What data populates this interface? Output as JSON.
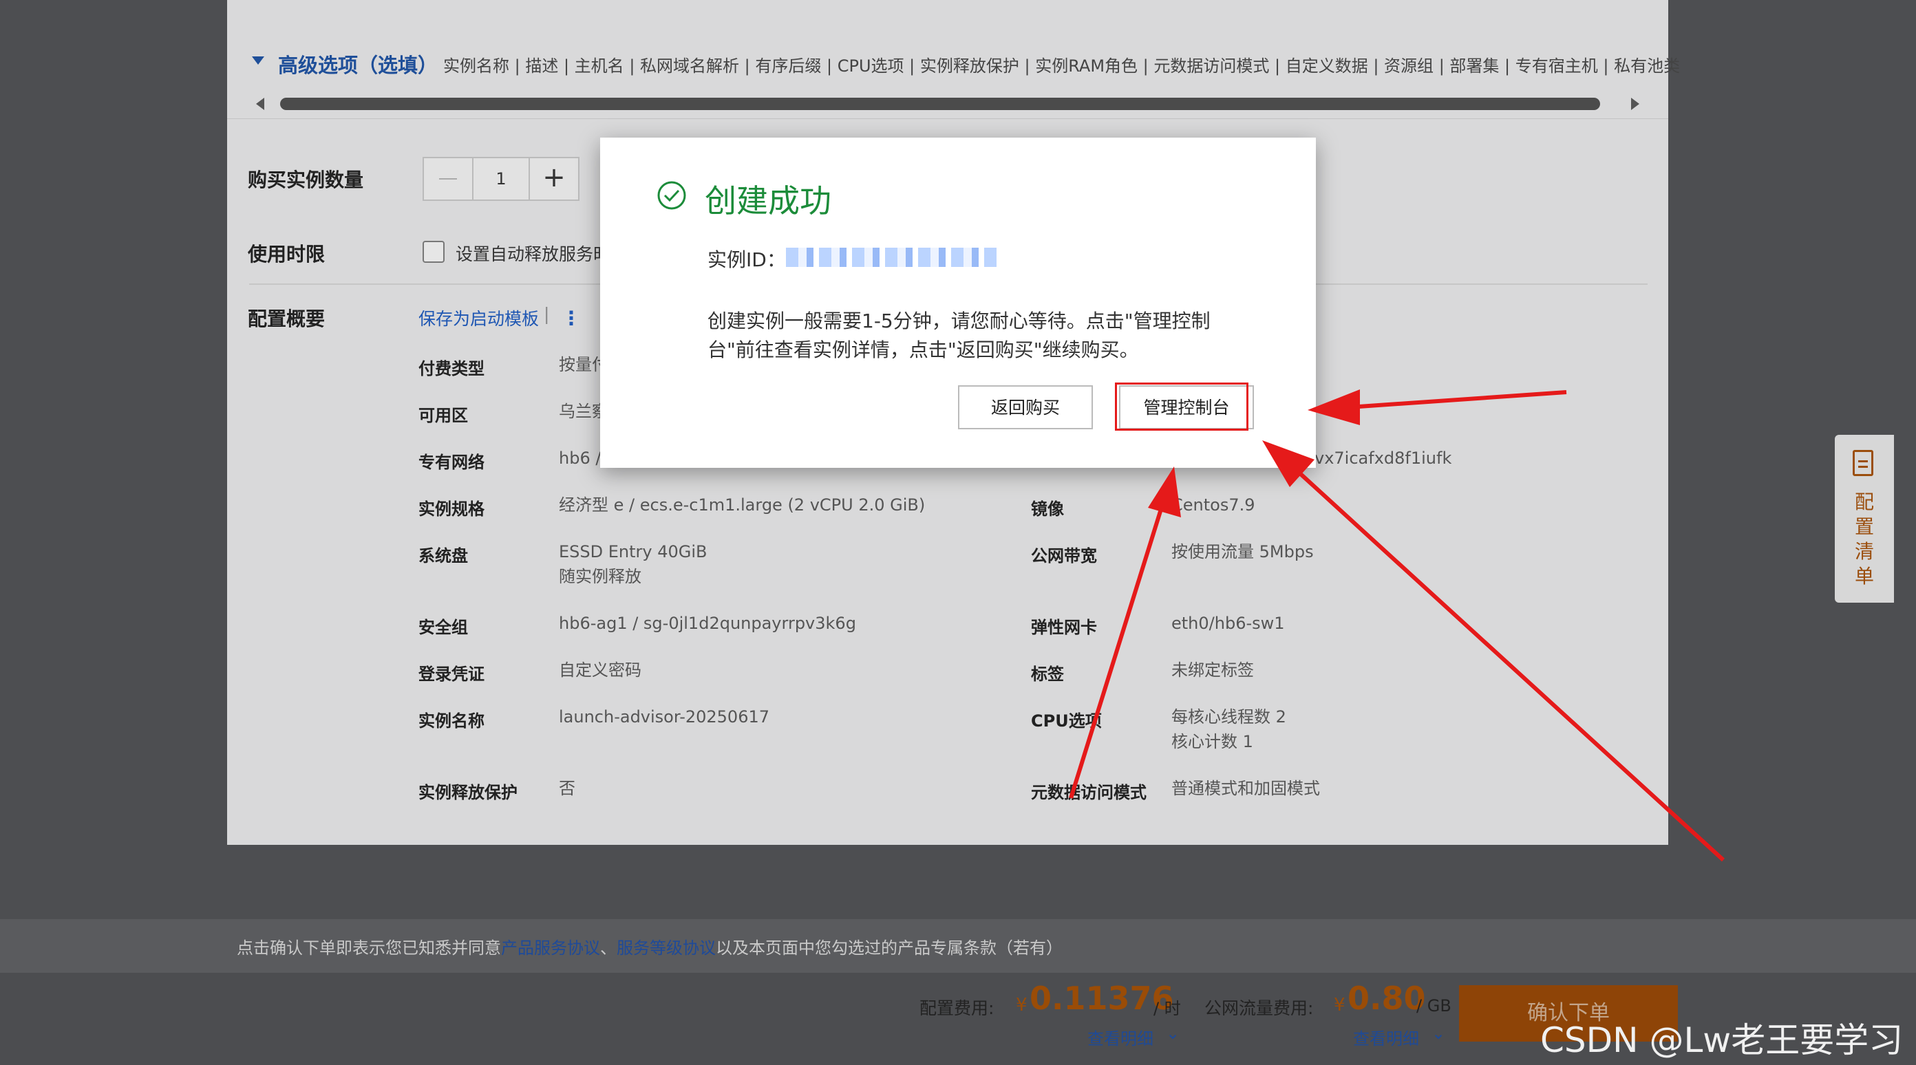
{
  "advanced": {
    "title": "高级选项（选填）",
    "items": "实例名称 | 描述 | 主机名 | 私网域名解析 | 有序后缀 | CPU选项 | 实例释放保护 | 实例RAM角色 | 元数据访问模式 | 自定义数据 | 资源组 | 部署集 | 专有宿主机 | 私有池类"
  },
  "purchase": {
    "quantity_label": "购买实例数量",
    "quantity_value": "1",
    "duration_label": "使用时限",
    "auto_release_text": "设置自动释放服务时"
  },
  "summary": {
    "label": "配置概要",
    "save_template": "保存为启动模板",
    "separator": "|",
    "more": "⋮",
    "left": [
      {
        "key": "付费类型",
        "value": "按量付"
      },
      {
        "key": "可用区",
        "value": "乌兰察"
      },
      {
        "key": "专有网络",
        "value": "hb6 / …"
      },
      {
        "key": "实例规格",
        "value": "经济型 e / ecs.e-c1m1.large (2 vCPU 2.0 GiB)"
      },
      {
        "key": "系统盘",
        "value": "ESSD Entry 40GiB",
        "value2": "随实例释放"
      },
      {
        "key": "安全组",
        "value": "hb6-ag1 / sg-0jl1d2qunpayrrpv3k6g"
      },
      {
        "key": "登录凭证",
        "value": "自定义密码"
      },
      {
        "key": "实例名称",
        "value": "launch-advisor-20250617"
      },
      {
        "key": "实例释放保护",
        "value": "否"
      }
    ],
    "right": [
      {
        "key": "",
        "value": "vx7icafxd8f1iufk"
      },
      {
        "key": "镜像",
        "value": "Centos7.9"
      },
      {
        "key": "公网带宽",
        "value": "按使用流量 5Mbps"
      },
      {
        "key": "弹性网卡",
        "value": "eth0/hb6-sw1"
      },
      {
        "key": "标签",
        "value": "未绑定标签"
      },
      {
        "key": "CPU选项",
        "value": "每核心线程数 2",
        "value2": "核心计数 1"
      },
      {
        "key": "元数据访问模式",
        "value": "普通模式和加固模式"
      }
    ]
  },
  "side_tab": {
    "label": "配置清单",
    "icon": "document-icon"
  },
  "agreement": {
    "prefix": "点击确认下单即表示您已知悉并同意",
    "link1": "产品服务协议",
    "sep": "、",
    "link2": "服务等级协议",
    "suffix": "以及本页面中您勾选过的产品专属条款（若有）"
  },
  "footer": {
    "config_fee_label": "配置费用:",
    "config_yen": "¥",
    "config_price": "0.11376",
    "config_unit": "/ 时",
    "config_detail": "查看明细",
    "traffic_fee_label": "公网流量费用:",
    "traffic_yen": "¥",
    "traffic_price": "0.80",
    "traffic_unit": "/ GB",
    "traffic_detail": "查看明细",
    "confirm_label": "确认下单"
  },
  "modal": {
    "title": "创建成功",
    "instance_label": "实例ID：",
    "description": "创建实例一般需要1-5分钟，请您耐心等待。点击\"管理控制台\"前往查看实例详情，点击\"返回购买\"继续购买。",
    "back_button": "返回购买",
    "console_button": "管理控制台"
  },
  "watermark": "CSDN @Lw老王要学习",
  "colors": {
    "success": "#1c8c3a",
    "annotation": "#e51a1a",
    "price": "#9a4c07"
  }
}
